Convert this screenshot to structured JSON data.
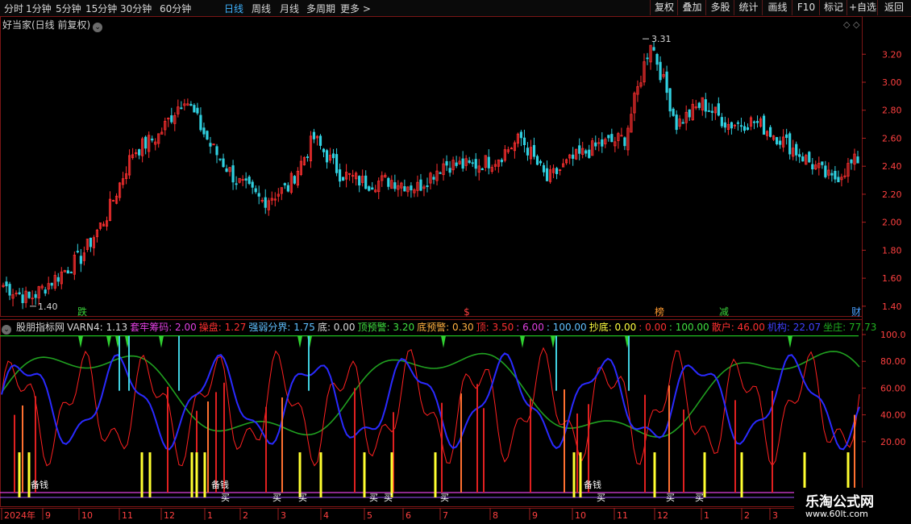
{
  "toolbar": {
    "tabs": [
      {
        "label": "分时"
      },
      {
        "label": "1分钟"
      },
      {
        "label": "5分钟"
      },
      {
        "label": "15分钟"
      },
      {
        "label": "30分钟"
      },
      {
        "label": "60分钟"
      },
      {
        "label": "日线",
        "active": true
      },
      {
        "label": "周线"
      },
      {
        "label": "月线"
      },
      {
        "label": "多周期"
      },
      {
        "label": "更多 >"
      }
    ],
    "right_buttons": [
      "复权",
      "叠加",
      "多股",
      "统计",
      "画线",
      "F10",
      "标记",
      "+自选",
      "返回"
    ]
  },
  "main_chart": {
    "title": "好当家(日线 前复权)",
    "high_label": "3.31",
    "low_label": "1.40",
    "y_ticks": [
      "3.20",
      "3.00",
      "2.80",
      "2.60",
      "2.40",
      "2.20",
      "2.00",
      "1.80",
      "1.60",
      "1.40"
    ],
    "event_marks": [
      {
        "text": "跌",
        "color": "#3ad03a"
      },
      {
        "text": "$",
        "color": "#ff4040"
      },
      {
        "text": "榜",
        "color": "#ff9a30"
      },
      {
        "text": "减",
        "color": "#3ad03a"
      },
      {
        "text": "财",
        "color": "#4aa0ff"
      }
    ]
  },
  "indicator": {
    "name": "股朋指标网",
    "params": [
      {
        "text": "VARN4: 1.13",
        "color": "#d8d8d8"
      },
      {
        "text": "套牢筹码: 2.00",
        "color": "#e040e0"
      },
      {
        "text": "操盘: 1.27",
        "color": "#ff3030"
      },
      {
        "text": "强弱分界: 1.75",
        "color": "#60c0ff"
      },
      {
        "text": "底: 0.00",
        "color": "#d8d8d8"
      },
      {
        "text": "顶预警: 3.20",
        "color": "#40e040"
      },
      {
        "text": "底预警: 0.30",
        "color": "#ffb040"
      },
      {
        "text": "顶: 3.50",
        "color": "#ff3030"
      },
      {
        "text": ": 6.00",
        "color": "#e040e0"
      },
      {
        "text": ": 100.00",
        "color": "#60c0ff"
      },
      {
        "text": "抄底: 0.00",
        "color": "#ffff40"
      },
      {
        "text": ": 0.00",
        "color": "#ff3030"
      },
      {
        "text": ": 100.00",
        "color": "#40e040"
      },
      {
        "text": "散户: 46.00",
        "color": "#ff3030"
      },
      {
        "text": "机构: 22.07",
        "color": "#4040ff"
      },
      {
        "text": "坐庄: 77.73",
        "color": "#20b020"
      }
    ],
    "y_ticks": [
      "100.0",
      "80.00",
      "60.00",
      "40.00",
      "20.00"
    ],
    "signal_labels": [
      "备钱",
      "备钱",
      "备钱",
      "买",
      "买",
      "买",
      "买",
      "买",
      "买",
      "买",
      "买",
      "买"
    ]
  },
  "time_axis": {
    "labels": [
      "2024年",
      "9",
      "10",
      "11",
      "12",
      "1",
      "2",
      "3",
      "4",
      "5",
      "6",
      "7",
      "8",
      "9",
      "10",
      "11",
      "12",
      "1",
      "2",
      "3"
    ]
  },
  "watermark": {
    "title": "乐淘公式网",
    "url": "www.60lt.com"
  },
  "chart_data": {
    "type": "candlestick",
    "title": "好当家(日线 前复权)",
    "price_range": [
      1.33,
      3.38
    ],
    "max_price": 3.31,
    "min_price": 1.4,
    "close_anchors": [
      1.55,
      1.45,
      1.6,
      1.75,
      2.05,
      2.5,
      2.62,
      2.9,
      2.55,
      2.3,
      2.15,
      2.25,
      2.6,
      2.35,
      2.28,
      2.3,
      2.25,
      2.42,
      2.4,
      2.45,
      2.6,
      2.3,
      2.45,
      2.55,
      2.6,
      3.3,
      2.7,
      2.85,
      2.7,
      2.72,
      2.6,
      2.45,
      2.3,
      2.45
    ],
    "indicator_range": [
      0,
      100
    ]
  }
}
